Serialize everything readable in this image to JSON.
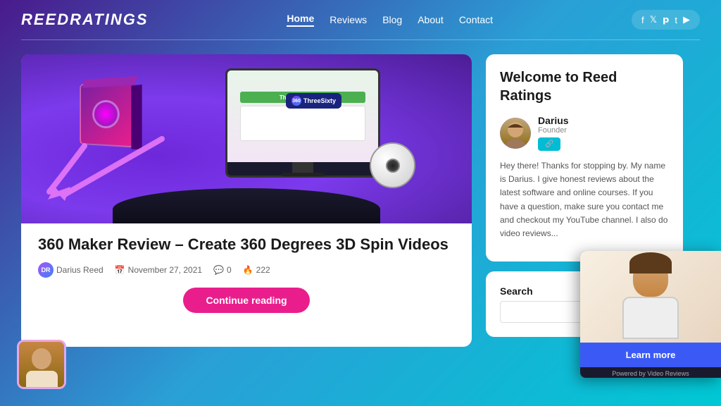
{
  "site": {
    "logo": "ReedRatings",
    "tagline": "Welcome to Reed Ratings"
  },
  "header": {
    "nav_items": [
      {
        "label": "Home",
        "active": true
      },
      {
        "label": "Reviews",
        "active": false
      },
      {
        "label": "Blog",
        "active": false
      },
      {
        "label": "About",
        "active": false
      },
      {
        "label": "Contact",
        "active": false
      }
    ],
    "social_icons": [
      "f",
      "t",
      "p",
      "t",
      "yt"
    ]
  },
  "article": {
    "title": "360 Maker Review – Create 360 Degrees 3D Spin Videos",
    "author": "Darius Reed",
    "date": "November 27, 2021",
    "comments": "0",
    "views": "222",
    "continue_btn": "Continue reading"
  },
  "sidebar": {
    "welcome_title": "Welcome to Reed Ratings",
    "author_name": "Darius",
    "author_role": "Founder",
    "author_text": "Hey there! Thanks for stopping by. My name is Darius. I give honest reviews about the latest software and online courses. If you have a question, make sure you contact me and checkout my YouTube channel. I also do video reviews...",
    "search_label": "Search",
    "search_placeholder": ""
  },
  "video_widget": {
    "learn_btn": "Learn more",
    "powered_text": "Powered by Video Reviews"
  }
}
